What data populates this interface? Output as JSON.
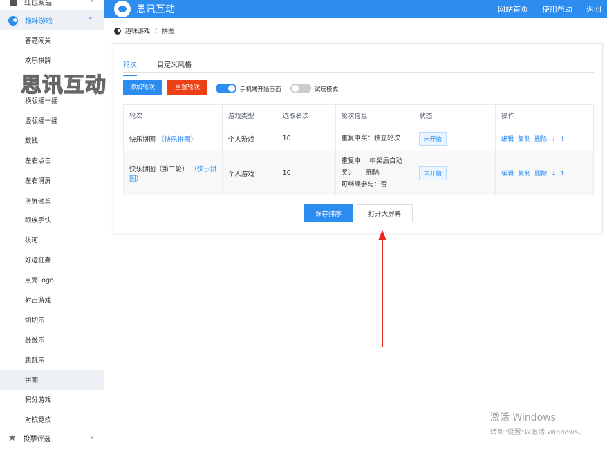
{
  "sidebar": {
    "top_item": "红包案品",
    "group": {
      "label": "趣味游戏"
    },
    "items": [
      "答题闯关",
      "欢乐棋牌",
      "赛马",
      "横版摇一摇",
      "竖版摇一摇",
      "数钱",
      "左右点击",
      "左右滑屏",
      "滑屏砸蛋",
      "眼疾手快",
      "拔河",
      "好运狂轰",
      "点亮Logo",
      "射击游戏",
      "切切乐",
      "敲敲乐",
      "跳跳乐",
      "拼图",
      "积分游戏",
      "对抗竞技"
    ],
    "active_index": 17,
    "bottom_item": "投票评选"
  },
  "logo_watermark": "思讯互动",
  "header": {
    "brand": "思讯互动",
    "nav": [
      "网站首页",
      "使用帮助",
      "返回"
    ]
  },
  "breadcrumb": {
    "parent": "趣味游戏",
    "sep": "/",
    "current": "拼图"
  },
  "tabs": [
    "轮次",
    "自定义风格"
  ],
  "toolbar": {
    "add_label": "添加轮次",
    "reset_label": "重置轮次",
    "switch1_label": "手机端开始画面",
    "switch2_label": "试玩模式"
  },
  "table": {
    "headers": [
      "轮次",
      "游戏类型",
      "选取名次",
      "轮次信息",
      "状态",
      "操作"
    ],
    "rows": [
      {
        "name": "快乐拼图",
        "link": "（快乐拼图）",
        "type": "个人游戏",
        "rank": "10",
        "info": [
          "重复中奖：独立轮次"
        ],
        "status": "未开始"
      },
      {
        "name": "快乐拼图（第二轮）",
        "link": "（快乐拼图）",
        "type": "个人游戏",
        "rank": "10",
        "info": [
          "重复中　 中奖后自动",
          "奖：　　 删除",
          "可继续参与：否"
        ],
        "status": "未开始"
      }
    ],
    "ops": [
      "编辑",
      "复制",
      "删除",
      "↓",
      "↑"
    ]
  },
  "footer_buttons": {
    "save": "保存排序",
    "screen": "打开大屏幕"
  },
  "windows_watermark": {
    "line1": "激活 Windows",
    "line2": "转到\"设置\"以激活 Windows。"
  },
  "colors": {
    "primary": "#2d8cf0",
    "danger": "#ed4014",
    "annotation": "#e8281e"
  }
}
